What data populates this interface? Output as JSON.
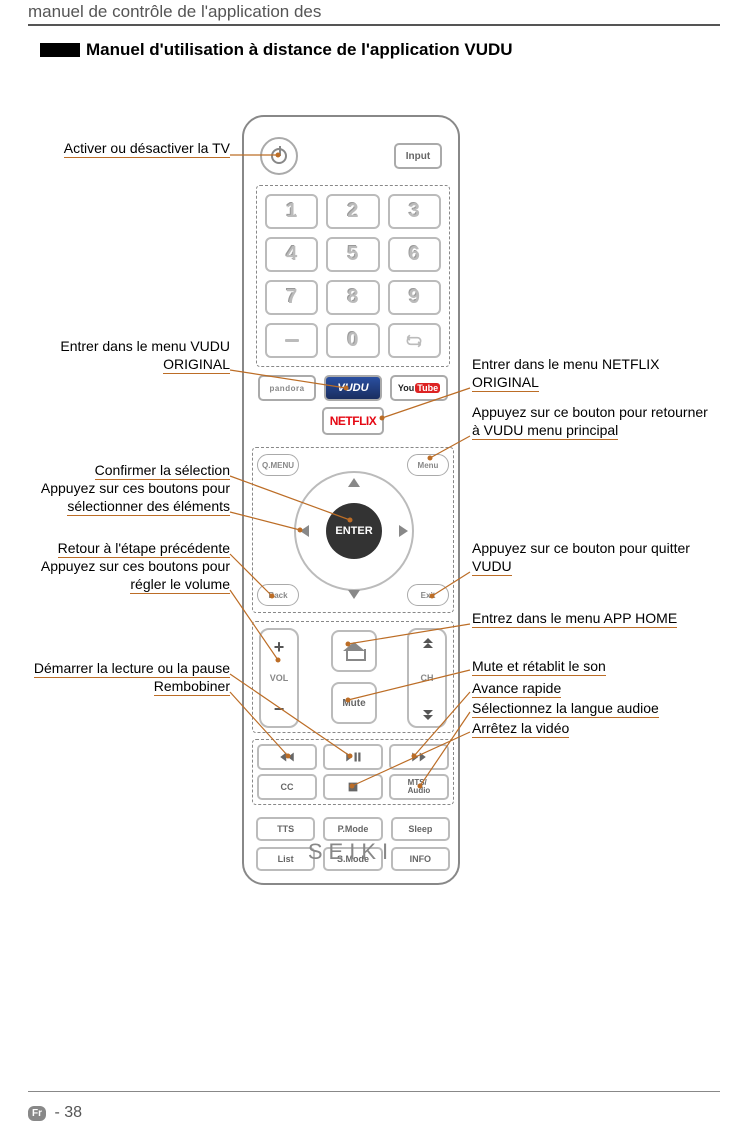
{
  "header": "manuel de contrôle de l'application des",
  "section_title": "Manuel d'utilisation à distance de l'application VUDU",
  "remote": {
    "input": "Input",
    "numbers": [
      "1",
      "2",
      "3",
      "4",
      "5",
      "6",
      "7",
      "8",
      "9",
      "",
      "0",
      ""
    ],
    "apps": {
      "pandora": "pandora",
      "vudu": "VUDU",
      "youtube": "YouTube",
      "netflix": "NETFLIX"
    },
    "nav": {
      "qmenu": "Q.MENU",
      "menu": "Menu",
      "back": "Back",
      "exit": "Exit",
      "enter": "ENTER"
    },
    "mid": {
      "vol": "VOL",
      "ch": "CH",
      "mute": "Mute"
    },
    "play": {
      "cc": "CC",
      "mts": "MTS/\nAudio"
    },
    "extra1": [
      "TTS",
      "P.Mode",
      "Sleep"
    ],
    "extra2": [
      "List",
      "S.Mode",
      "INFO"
    ],
    "brand": "SEIKI"
  },
  "callouts": {
    "left": {
      "power": "Activer ou désactiver la TV",
      "vudu_menu1": "Entrer dans le menu VUDU",
      "vudu_menu2": "ORIGINAL",
      "confirm": "Confirmer la sélection",
      "select1": "Appuyez sur ces boutons pour",
      "select2": "sélectionner des éléments",
      "back": "Retour à l'étape précédente",
      "vol1": "Appuyez sur ces boutons pour",
      "vol2": "régler le volume",
      "playpause": "Démarrer la lecture ou la pause",
      "rewind": "Rembobiner"
    },
    "right": {
      "netflix1": "Entrer dans le menu NETFLIX",
      "netflix2": "ORIGINAL",
      "menu1": "Appuyez sur ce bouton pour retourner",
      "menu2": "à VUDU menu principal",
      "exit1": "Appuyez sur ce bouton pour quitter",
      "exit2": "VUDU",
      "home": "Entrez dans le menu APP HOME",
      "mute": "Mute et rétablit le son",
      "ff": "Avance rapide",
      "audio": "Sélectionnez la langue audioe",
      "stop": "Arrêtez la vidéo"
    }
  },
  "footer": {
    "badge": "Fr",
    "page": "38"
  }
}
